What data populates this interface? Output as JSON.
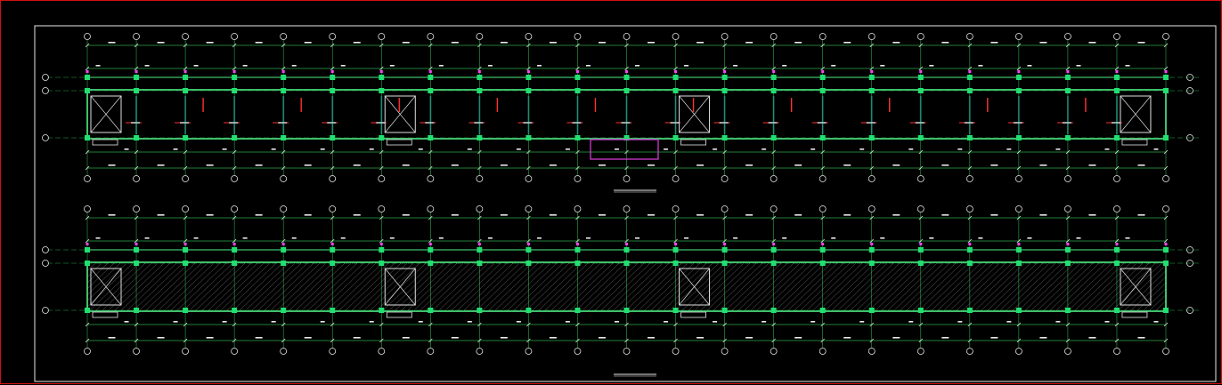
{
  "drawing": {
    "type": "cad-floor-plan",
    "background": "#000000",
    "colors": {
      "viewport_border": "#d01010",
      "frame": "#e8e8e8",
      "axis_line": "#2aa84a",
      "dim_line": "#2aa84a",
      "wall": "#3fbf6a",
      "column": "#20e070",
      "column_magenta": "#ff40ff",
      "beam_red": "#ff3030",
      "cyan_detail": "#30e0e0",
      "hatch": "#c8c8c8",
      "stair": "#e0e0e0",
      "callout_box": "#e040e0",
      "text": "#e8e8e8"
    },
    "plans": [
      {
        "id": "plan-top",
        "axis_count": 23,
        "stair_bays": [
          1,
          7,
          13,
          22
        ],
        "hatched": false
      },
      {
        "id": "plan-bottom",
        "axis_count": 23,
        "stair_bays": [
          1,
          7,
          13,
          22
        ],
        "hatched": true
      }
    ],
    "title_blocks": [
      {
        "title": "",
        "scale": ""
      },
      {
        "title": "",
        "scale": ""
      }
    ],
    "notes": []
  }
}
